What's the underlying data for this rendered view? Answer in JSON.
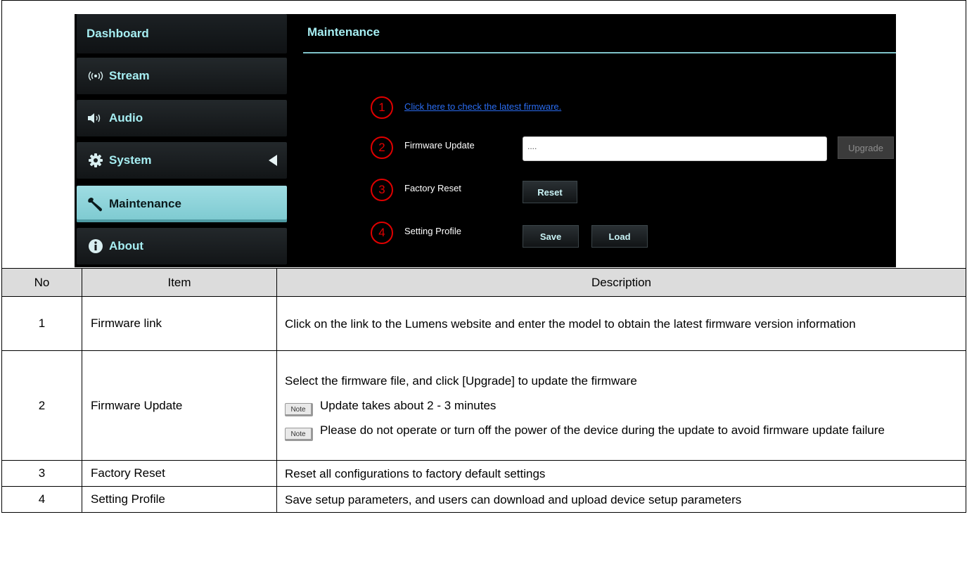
{
  "sidebar": {
    "dashboard": "Dashboard",
    "items": [
      {
        "label": "Stream",
        "icon": "broadcast-icon"
      },
      {
        "label": "Audio",
        "icon": "speaker-icon"
      },
      {
        "label": "System",
        "icon": "gear-icon"
      },
      {
        "label": "Maintenance",
        "icon": "wrench-icon"
      },
      {
        "label": "About",
        "icon": "info-icon"
      }
    ],
    "active": "Maintenance"
  },
  "main": {
    "title": "Maintenance",
    "markers": [
      "1",
      "2",
      "3",
      "4"
    ],
    "firmware_link": "Click here to check the latest firmware.",
    "firmware_update_label": "Firmware Update",
    "firmware_input_value": "....",
    "upgrade_button": "Upgrade",
    "factory_reset_label": "Factory Reset",
    "reset_button": "Reset",
    "setting_profile_label": "Setting Profile",
    "save_button": "Save",
    "load_button": "Load"
  },
  "table": {
    "headers": {
      "no": "No",
      "item": "Item",
      "description": "Description"
    },
    "note_tag": "Note",
    "rows": [
      {
        "no": "1",
        "item": "Firmware link",
        "desc": "Click on the link to the Lumens website and enter the model to obtain the latest firmware version information"
      },
      {
        "no": "2",
        "item": "Firmware Update",
        "desc": "Select the firmware file, and click [Upgrade] to update the firmware",
        "note1": "Update takes about 2 - 3 minutes",
        "note2": "Please do not operate or turn off the power of the device during the update to avoid firmware update failure"
      },
      {
        "no": "3",
        "item": "Factory Reset",
        "desc": "Reset all configurations to factory default settings"
      },
      {
        "no": "4",
        "item": "Setting Profile",
        "desc": "Save setup parameters, and users can download and upload device setup parameters"
      }
    ]
  },
  "colors": {
    "accent": "#a6eef2",
    "active_nav": "#8fd5dc",
    "marker": "#e00000",
    "link": "#2a6cf0"
  }
}
